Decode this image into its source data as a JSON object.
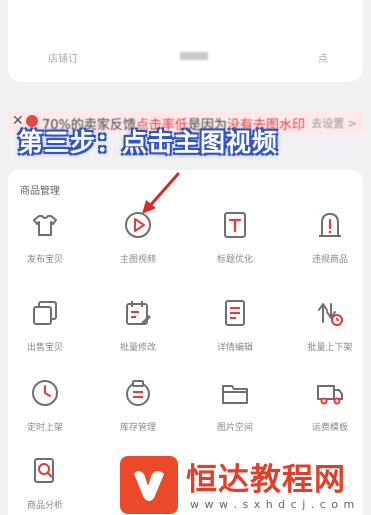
{
  "top": {
    "labels": [
      "店铺订",
      "",
      "点"
    ]
  },
  "banner": {
    "close_symbol": "✕",
    "text_prefix": "70%的卖家反馈",
    "text_red": "点击率低",
    "text_mid": "是因为",
    "text_red2": "没有去图水印",
    "tail": "去设置 >"
  },
  "overlay": {
    "text": "第三步：点击主图视频"
  },
  "section": {
    "title": "商品管理"
  },
  "tools": [
    {
      "label": "发布宝贝",
      "icon": "tshirt-icon"
    },
    {
      "label": "主图视频",
      "icon": "play-circle-icon"
    },
    {
      "label": "标题优化",
      "icon": "text-t-icon"
    },
    {
      "label": "违规商品",
      "icon": "warning-icon"
    },
    {
      "label": "出售宝贝",
      "icon": "copy-icon"
    },
    {
      "label": "批量修改",
      "icon": "calendar-edit-icon"
    },
    {
      "label": "详情编辑",
      "icon": "document-icon"
    },
    {
      "label": "批量上下架",
      "icon": "transfer-icon"
    },
    {
      "label": "定时上架",
      "icon": "clock-icon"
    },
    {
      "label": "库存管理",
      "icon": "inventory-icon"
    },
    {
      "label": "图片空间",
      "icon": "folder-icon"
    },
    {
      "label": "运费模板",
      "icon": "truck-icon"
    },
    {
      "label": "商品分析",
      "icon": "search-doc-icon"
    }
  ],
  "watermark": {
    "title": "恒达教程网",
    "url": "w w w . s x h d c j . c o m"
  },
  "colors": {
    "icon": "#6f6f6f",
    "accent": "#e23c3c",
    "arrow": "#d8282a"
  }
}
